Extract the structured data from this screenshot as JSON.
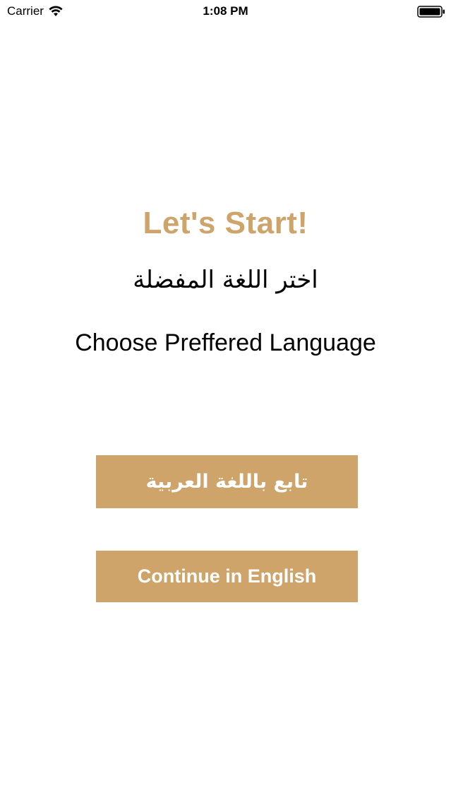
{
  "status_bar": {
    "carrier": "Carrier",
    "time": "1:08 PM",
    "icons": [
      "wifi-icon",
      "battery-icon"
    ]
  },
  "main": {
    "title": "Let's Start!",
    "arabic_prompt": "اختر اللغة المفضلة",
    "english_prompt": "Choose Preffered Language",
    "arabic_button_label": "تابع باللغة العربية",
    "english_button_label": "Continue in English"
  },
  "colors": {
    "accent": "#cfa46b",
    "button_text": "#ffffff",
    "background": "#ffffff"
  }
}
